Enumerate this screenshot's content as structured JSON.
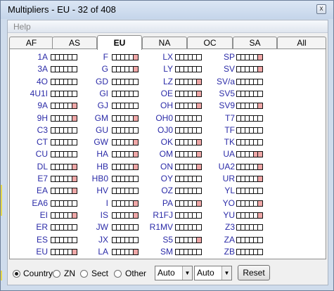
{
  "window": {
    "title": "Multipliers - EU - 32 of 408",
    "close_label": "x"
  },
  "menu": {
    "help": "Help"
  },
  "tabs": [
    {
      "label": "AF",
      "active": false
    },
    {
      "label": "AS",
      "active": false
    },
    {
      "label": "EU",
      "active": true
    },
    {
      "label": "NA",
      "active": false
    },
    {
      "label": "OC",
      "active": false
    },
    {
      "label": "SA",
      "active": false
    },
    {
      "label": "All",
      "active": false
    }
  ],
  "columns": [
    [
      {
        "call": "1A",
        "worked": [
          0,
          0,
          0,
          0,
          0,
          0
        ]
      },
      {
        "call": "3A",
        "worked": [
          0,
          0,
          0,
          0,
          0,
          0
        ]
      },
      {
        "call": "4O",
        "worked": [
          0,
          0,
          0,
          0,
          0,
          0
        ]
      },
      {
        "call": "4U1I",
        "worked": [
          0,
          0,
          0,
          0,
          0,
          0
        ]
      },
      {
        "call": "9A",
        "worked": [
          0,
          0,
          0,
          0,
          0,
          1
        ]
      },
      {
        "call": "9H",
        "worked": [
          0,
          0,
          0,
          0,
          0,
          1
        ]
      },
      {
        "call": "C3",
        "worked": [
          0,
          0,
          0,
          0,
          0,
          0
        ]
      },
      {
        "call": "CT",
        "worked": [
          0,
          0,
          0,
          0,
          0,
          0
        ]
      },
      {
        "call": "CU",
        "worked": [
          0,
          0,
          0,
          0,
          0,
          0
        ]
      },
      {
        "call": "DL",
        "worked": [
          0,
          0,
          0,
          0,
          0,
          1
        ]
      },
      {
        "call": "E7",
        "worked": [
          0,
          0,
          0,
          0,
          0,
          1
        ]
      },
      {
        "call": "EA",
        "worked": [
          0,
          0,
          0,
          0,
          0,
          1
        ]
      },
      {
        "call": "EA6",
        "worked": [
          0,
          0,
          0,
          0,
          0,
          0
        ]
      },
      {
        "call": "EI",
        "worked": [
          0,
          0,
          0,
          0,
          0,
          1
        ]
      },
      {
        "call": "ER",
        "worked": [
          0,
          0,
          0,
          0,
          0,
          0
        ]
      },
      {
        "call": "ES",
        "worked": [
          0,
          0,
          0,
          0,
          0,
          0
        ]
      },
      {
        "call": "EU",
        "worked": [
          0,
          0,
          0,
          0,
          0,
          1
        ]
      }
    ],
    [
      {
        "call": "F",
        "worked": [
          0,
          0,
          0,
          0,
          0,
          1
        ]
      },
      {
        "call": "G",
        "worked": [
          0,
          0,
          0,
          0,
          0,
          1
        ]
      },
      {
        "call": "GD",
        "worked": [
          0,
          0,
          0,
          0,
          0,
          0
        ]
      },
      {
        "call": "GI",
        "worked": [
          0,
          0,
          0,
          0,
          0,
          0
        ]
      },
      {
        "call": "GJ",
        "worked": [
          0,
          0,
          0,
          0,
          0,
          0
        ]
      },
      {
        "call": "GM",
        "worked": [
          0,
          0,
          0,
          0,
          0,
          1
        ]
      },
      {
        "call": "GU",
        "worked": [
          0,
          0,
          0,
          0,
          0,
          0
        ]
      },
      {
        "call": "GW",
        "worked": [
          0,
          0,
          0,
          0,
          0,
          1
        ]
      },
      {
        "call": "HA",
        "worked": [
          0,
          0,
          0,
          0,
          0,
          1
        ]
      },
      {
        "call": "HB",
        "worked": [
          0,
          0,
          0,
          0,
          0,
          1
        ]
      },
      {
        "call": "HB0",
        "worked": [
          0,
          0,
          0,
          0,
          0,
          0
        ]
      },
      {
        "call": "HV",
        "worked": [
          0,
          0,
          0,
          0,
          0,
          0
        ]
      },
      {
        "call": "I",
        "worked": [
          0,
          0,
          0,
          0,
          0,
          1
        ]
      },
      {
        "call": "IS",
        "worked": [
          0,
          0,
          0,
          0,
          0,
          1
        ]
      },
      {
        "call": "JW",
        "worked": [
          0,
          0,
          0,
          0,
          0,
          0
        ]
      },
      {
        "call": "JX",
        "worked": [
          0,
          0,
          0,
          0,
          0,
          0
        ]
      },
      {
        "call": "LA",
        "worked": [
          0,
          0,
          0,
          0,
          0,
          1
        ]
      }
    ],
    [
      {
        "call": "LX",
        "worked": [
          0,
          0,
          0,
          0,
          0,
          0
        ]
      },
      {
        "call": "LY",
        "worked": [
          0,
          0,
          0,
          0,
          0,
          0
        ]
      },
      {
        "call": "LZ",
        "worked": [
          0,
          0,
          0,
          0,
          0,
          1
        ]
      },
      {
        "call": "OE",
        "worked": [
          0,
          0,
          0,
          0,
          0,
          1
        ]
      },
      {
        "call": "OH",
        "worked": [
          0,
          0,
          0,
          0,
          0,
          1
        ]
      },
      {
        "call": "OH0",
        "worked": [
          0,
          0,
          0,
          0,
          0,
          0
        ]
      },
      {
        "call": "OJ0",
        "worked": [
          0,
          0,
          0,
          0,
          0,
          0
        ]
      },
      {
        "call": "OK",
        "worked": [
          0,
          0,
          0,
          0,
          0,
          1
        ]
      },
      {
        "call": "OM",
        "worked": [
          0,
          0,
          0,
          0,
          0,
          1
        ]
      },
      {
        "call": "ON",
        "worked": [
          0,
          0,
          0,
          0,
          0,
          1
        ]
      },
      {
        "call": "OY",
        "worked": [
          0,
          0,
          0,
          0,
          0,
          0
        ]
      },
      {
        "call": "OZ",
        "worked": [
          0,
          0,
          0,
          0,
          0,
          0
        ]
      },
      {
        "call": "PA",
        "worked": [
          0,
          0,
          0,
          0,
          0,
          1
        ]
      },
      {
        "call": "R1FJ",
        "worked": [
          0,
          0,
          0,
          0,
          0,
          0
        ]
      },
      {
        "call": "R1MV",
        "worked": [
          0,
          0,
          0,
          0,
          0,
          0
        ]
      },
      {
        "call": "S5",
        "worked": [
          0,
          0,
          0,
          0,
          0,
          1
        ]
      },
      {
        "call": "SM",
        "worked": [
          0,
          0,
          0,
          0,
          0,
          0
        ]
      }
    ],
    [
      {
        "call": "SP",
        "worked": [
          0,
          0,
          0,
          0,
          0,
          1
        ]
      },
      {
        "call": "SV",
        "worked": [
          0,
          0,
          0,
          0,
          0,
          1
        ]
      },
      {
        "call": "SV/a",
        "worked": [
          0,
          0,
          0,
          0,
          0,
          0
        ]
      },
      {
        "call": "SV5",
        "worked": [
          0,
          0,
          0,
          0,
          0,
          0
        ]
      },
      {
        "call": "SV9",
        "worked": [
          0,
          0,
          0,
          0,
          0,
          1
        ]
      },
      {
        "call": "T7",
        "worked": [
          0,
          0,
          0,
          0,
          0,
          0
        ]
      },
      {
        "call": "TF",
        "worked": [
          0,
          0,
          0,
          0,
          0,
          0
        ]
      },
      {
        "call": "TK",
        "worked": [
          0,
          0,
          0,
          0,
          0,
          0
        ]
      },
      {
        "call": "UA",
        "worked": [
          0,
          0,
          0,
          0,
          1,
          1
        ]
      },
      {
        "call": "UA2",
        "worked": [
          0,
          0,
          0,
          0,
          0,
          1
        ]
      },
      {
        "call": "UR",
        "worked": [
          0,
          0,
          0,
          0,
          0,
          1
        ]
      },
      {
        "call": "YL",
        "worked": [
          0,
          0,
          0,
          0,
          0,
          0
        ]
      },
      {
        "call": "YO",
        "worked": [
          0,
          0,
          0,
          0,
          0,
          1
        ]
      },
      {
        "call": "YU",
        "worked": [
          0,
          0,
          0,
          0,
          0,
          1
        ]
      },
      {
        "call": "Z3",
        "worked": [
          0,
          0,
          0,
          0,
          0,
          0
        ]
      },
      {
        "call": "ZA",
        "worked": [
          0,
          0,
          0,
          0,
          0,
          0
        ]
      },
      {
        "call": "ZB",
        "worked": [
          0,
          0,
          0,
          0,
          0,
          0
        ]
      }
    ]
  ],
  "colors": {
    "worked_box": "#f0a8a8",
    "call_text": "#2b2ba8"
  },
  "bottom": {
    "radios": [
      {
        "label": "Country",
        "checked": true
      },
      {
        "label": "ZN",
        "checked": false
      },
      {
        "label": "Sect",
        "checked": false
      },
      {
        "label": "Other",
        "checked": false
      }
    ],
    "select1": "Auto",
    "select2": "Auto",
    "reset_label": "Reset"
  }
}
